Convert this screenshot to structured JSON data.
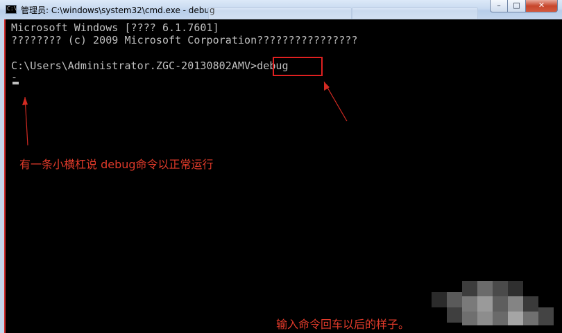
{
  "window": {
    "title": "管理员: C:\\windows\\system32\\cmd.exe - debug",
    "icon_label": "C:\\"
  },
  "controls": {
    "minimize": "–",
    "maximize": "□",
    "close": "✕"
  },
  "console": {
    "lines": [
      "Microsoft Windows [???? 6.1.7601]",
      "???????? (c) 2009 Microsoft Corporation????????????????",
      "C:\\Users\\Administrator.ZGC-20130802AMV>",
      "-"
    ],
    "typed_command": "debug"
  },
  "annotations": {
    "note_dash": "有一条小横杠说 debug命令以正常运行",
    "note_after": "输入命令回车以后的样子。"
  },
  "colors": {
    "console_bg": "#000000",
    "console_text": "#c0c0c0",
    "annotation": "#e03a2a"
  }
}
